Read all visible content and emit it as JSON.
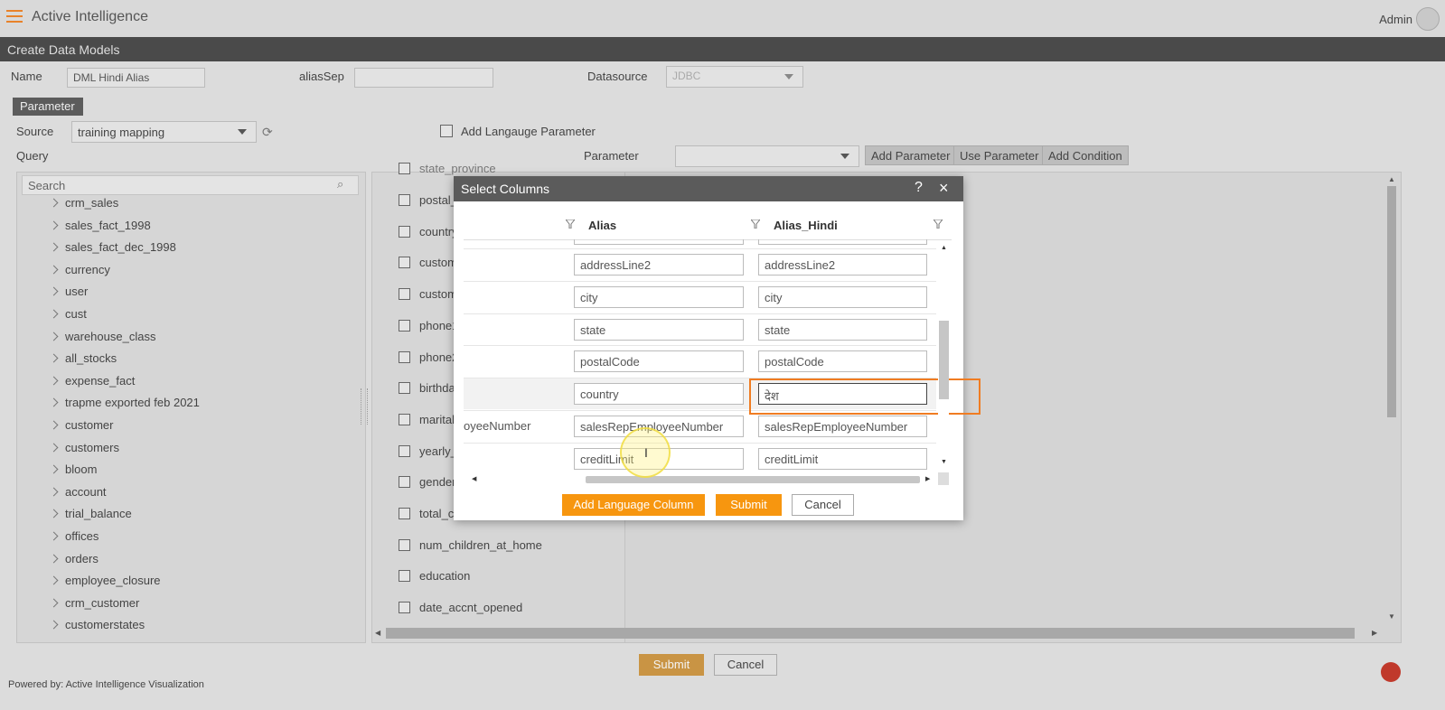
{
  "header": {
    "app_title": "Active Intelligence",
    "user": "Admin"
  },
  "page": {
    "title": "Create Data Models"
  },
  "form": {
    "name_label": "Name",
    "name_value": "DML Hindi Alias",
    "aliassep_label": "aliasSep",
    "aliassep_value": "",
    "datasource_label": "Datasource",
    "datasource_value": "JDBC",
    "parameter_tab": "Parameter",
    "source_label": "Source",
    "source_value": "training mapping",
    "add_language_param_label": "Add Langauge Parameter",
    "query_label": "Query",
    "parameter_label": "Parameter",
    "add_parameter_btn": "Add Parameter",
    "use_parameter_btn": "Use Parameter",
    "add_condition_btn": "Add Condition"
  },
  "tree": {
    "search_placeholder": "Search",
    "items": [
      "crm_sales",
      "sales_fact_1998",
      "sales_fact_dec_1998",
      "currency",
      "user",
      "cust",
      "warehouse_class",
      "all_stocks",
      "expense_fact",
      "trapme exported feb 2021",
      "customer",
      "customers",
      "bloom",
      "account",
      "trial_balance",
      "offices",
      "orders",
      "employee_closure",
      "crm_customer",
      "customerstates"
    ]
  },
  "columns": {
    "top_partial": "state_province",
    "items": [
      "postal_",
      "country",
      "custom",
      "custom",
      "phone1",
      "phone2",
      "birthda",
      "marital",
      "yearly_",
      "gender",
      "total_c",
      "num_children_at_home",
      "education",
      "date_accnt_opened"
    ]
  },
  "modal": {
    "title": "Select Columns",
    "help": "?",
    "close": "×",
    "col_alias": "Alias",
    "col_alias_hindi": "Alias_Hindi",
    "rows": [
      {
        "left": "",
        "alias": "addressLine2",
        "hindi": "addressLine2"
      },
      {
        "left": "",
        "alias": "city",
        "hindi": "city"
      },
      {
        "left": "",
        "alias": "state",
        "hindi": "state"
      },
      {
        "left": "",
        "alias": "postalCode",
        "hindi": "postalCode"
      },
      {
        "left": "",
        "alias": "country",
        "hindi": "देश"
      },
      {
        "left": "oyeeNumber",
        "alias": "salesRepEmployeeNumber",
        "hindi": "salesRepEmployeeNumber"
      },
      {
        "left": "",
        "alias": "creditLimit",
        "hindi": "creditLimit"
      }
    ],
    "add_language_btn": "Add Language Column",
    "submit_btn": "Submit",
    "cancel_btn": "Cancel"
  },
  "footer": {
    "submit": "Submit",
    "cancel": "Cancel",
    "powered_by": "Powered by: Active Intelligence Visualization"
  },
  "colors": {
    "accent": "#f7960f",
    "highlight": "#f07c22",
    "header_dark": "#5b5b5b"
  }
}
